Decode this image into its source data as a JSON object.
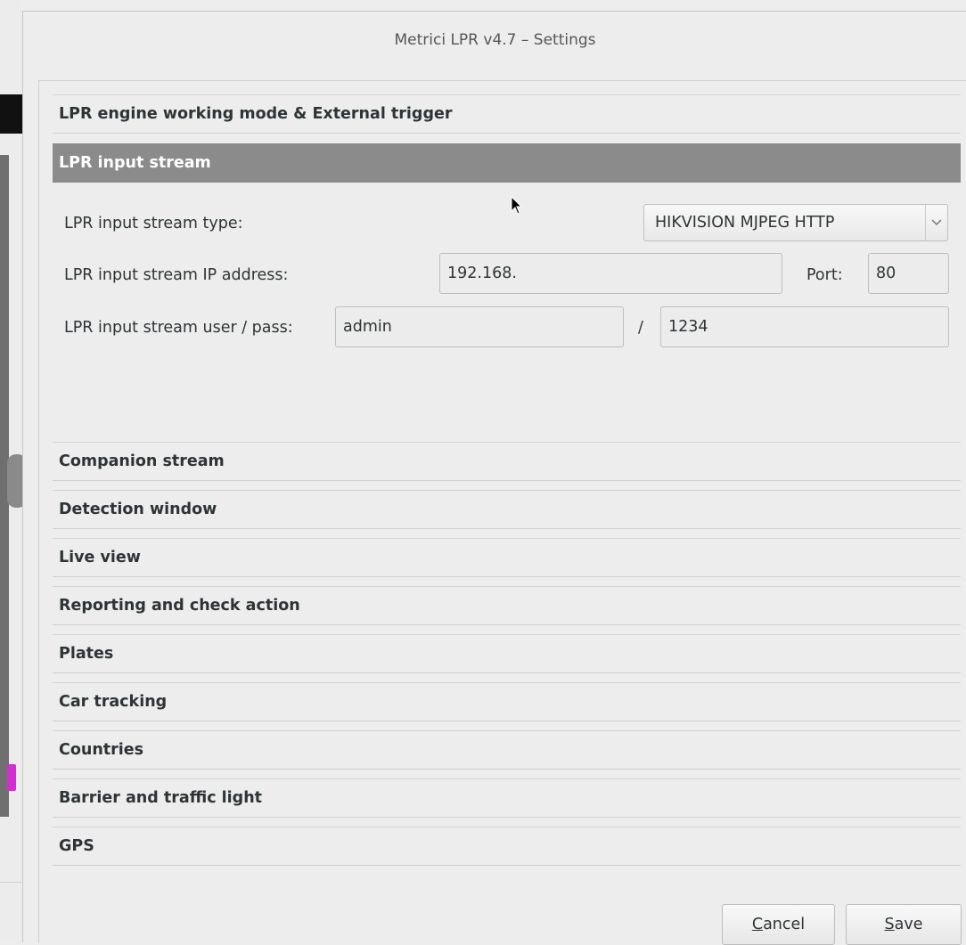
{
  "window": {
    "title": "Metrici LPR v4.7 – Settings"
  },
  "sections": {
    "engine": "LPR engine working mode & External trigger",
    "input_stream": "LPR input stream",
    "companion": "Companion stream",
    "detection": "Detection window",
    "live_view": "Live view",
    "reporting": "Reporting and check action",
    "plates": "Plates",
    "car_tracking": "Car tracking",
    "countries": "Countries",
    "barrier": "Barrier and traffic light",
    "gps": "GPS"
  },
  "input_stream": {
    "type_label": "LPR input stream type:",
    "type_value": "HIKVISION MJPEG HTTP",
    "ip_label": "LPR input stream IP address:",
    "ip_value": "192.168.",
    "port_label": "Port:",
    "port_value": "80",
    "userpass_label": "LPR input stream user / pass:",
    "user_value": "admin",
    "separator": "/",
    "pass_value": "1234"
  },
  "buttons": {
    "cancel_mnemonic": "C",
    "cancel_rest": "ancel",
    "save_mnemonic": "S",
    "save_rest": "ave"
  },
  "colors": {
    "active_header": "#8b8b8b",
    "background": "#ededed"
  }
}
